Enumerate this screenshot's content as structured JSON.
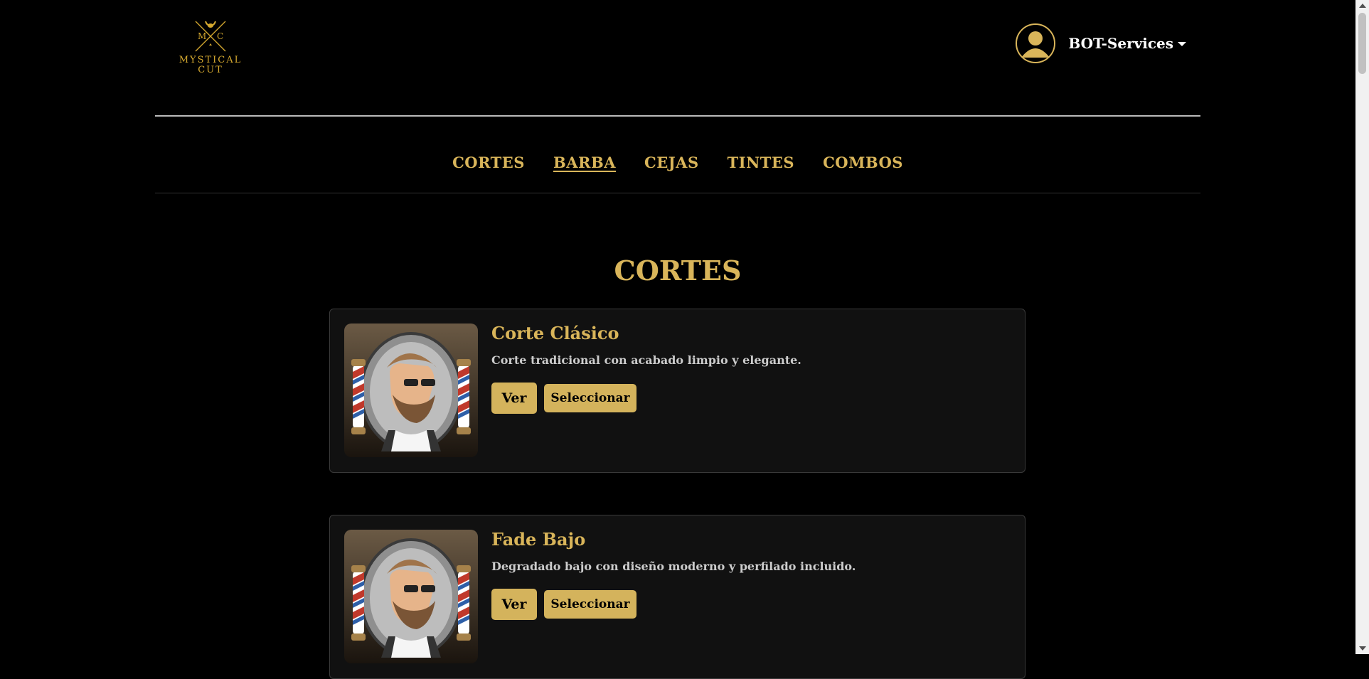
{
  "brand": {
    "initials_left": "M",
    "initials_right": "C",
    "name_line1": "MYSTICAL",
    "name_line2": "CUT"
  },
  "user": {
    "name": "BOT-Services"
  },
  "nav": {
    "items": [
      {
        "label": "CORTES",
        "active": false
      },
      {
        "label": "BARBA",
        "active": true
      },
      {
        "label": "CEJAS",
        "active": false
      },
      {
        "label": "TINTES",
        "active": false
      },
      {
        "label": "COMBOS",
        "active": false
      }
    ]
  },
  "section": {
    "title": "CORTES"
  },
  "services": [
    {
      "title": "Corte Clásico",
      "description": "Corte tradicional con acabado limpio y elegante.",
      "view_label": "Ver",
      "select_label": "Seleccionar"
    },
    {
      "title": "Fade Bajo",
      "description": "Degradado bajo con diseño moderno y perfilado incluido.",
      "view_label": "Ver",
      "select_label": "Seleccionar"
    }
  ],
  "colors": {
    "accent": "#d9b55a",
    "background": "#000000",
    "card": "#111111",
    "button": "#d4b35c"
  }
}
